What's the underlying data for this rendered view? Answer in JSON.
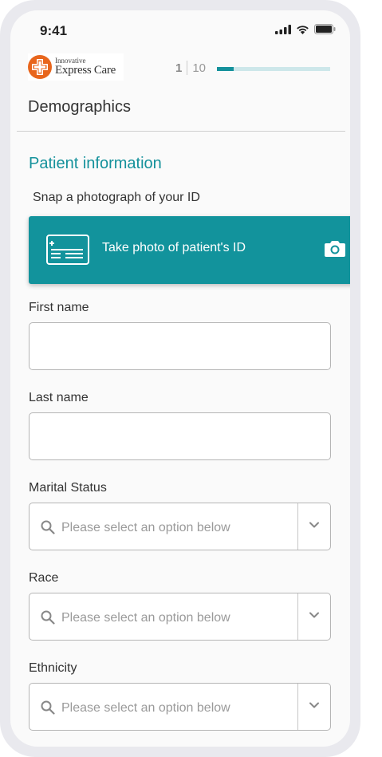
{
  "status_bar": {
    "time": "9:41"
  },
  "header": {
    "logo": {
      "top_text": "Innovative",
      "bottom_text": "Express Care"
    },
    "progress": {
      "current": "1",
      "total": "10",
      "fraction": 0.15
    },
    "title": "Demographics"
  },
  "section": {
    "title": "Patient information",
    "snap_label": "Snap a photograph of your ID",
    "photo_button": {
      "label": "Take photo of patient's ID"
    }
  },
  "fields": {
    "first_name": {
      "label": "First name",
      "value": ""
    },
    "last_name": {
      "label": "Last name",
      "value": ""
    },
    "marital_status": {
      "label": "Marital Status",
      "placeholder": "Please select an option below"
    },
    "race": {
      "label": "Race",
      "placeholder": "Please select an option below"
    },
    "ethnicity": {
      "label": "Ethnicity",
      "placeholder": "Please select an option below"
    }
  },
  "colors": {
    "accent": "#14919b",
    "logo": "#e8661d"
  }
}
